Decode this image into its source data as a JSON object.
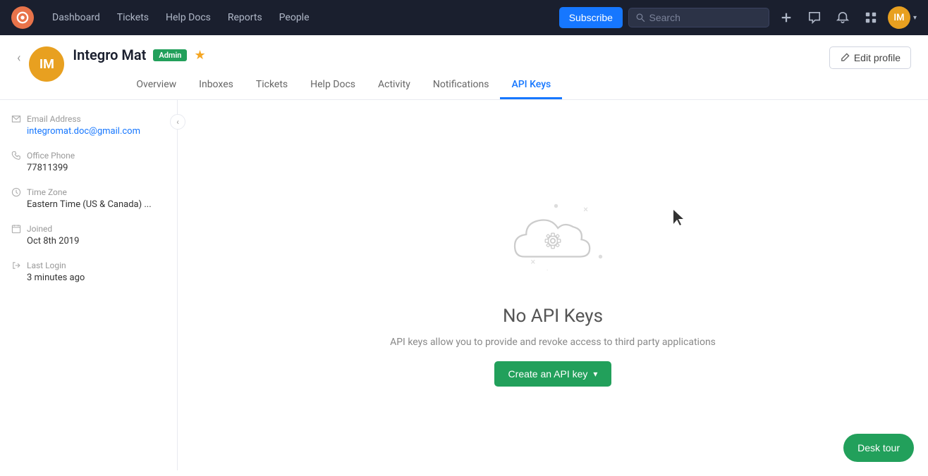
{
  "topnav": {
    "logo_letter": "○",
    "links": [
      "Dashboard",
      "Tickets",
      "Help Docs",
      "Reports",
      "People"
    ],
    "subscribe_label": "Subscribe",
    "search_placeholder": "Search",
    "add_icon": "+",
    "chat_icon": "💬",
    "bell_icon": "🔔",
    "grid_icon": "⊞",
    "avatar_initials": "IM"
  },
  "profile": {
    "avatar_initials": "IM",
    "name": "Integro Mat",
    "admin_badge": "Admin",
    "edit_profile_label": "Edit profile",
    "back_arrow": "‹",
    "star": "★"
  },
  "tabs": {
    "items": [
      {
        "label": "Overview",
        "active": false
      },
      {
        "label": "Inboxes",
        "active": false
      },
      {
        "label": "Tickets",
        "active": false
      },
      {
        "label": "Help Docs",
        "active": false
      },
      {
        "label": "Activity",
        "active": false
      },
      {
        "label": "Notifications",
        "active": false
      },
      {
        "label": "API Keys",
        "active": true
      }
    ]
  },
  "sidebar": {
    "collapse_arrow": "‹",
    "email_label": "Email Address",
    "email_value": "integromat.doc@gmail.com",
    "phone_label": "Office Phone",
    "phone_value": "77811399",
    "timezone_label": "Time Zone",
    "timezone_value": "Eastern Time (US & Canada) ...",
    "joined_label": "Joined",
    "joined_value": "Oct 8th 2019",
    "last_login_label": "Last Login",
    "last_login_value": "3 minutes ago"
  },
  "empty_state": {
    "title": "No API Keys",
    "description": "API keys allow you to provide and revoke access to third party applications",
    "create_button": "Create an API key",
    "create_button_arrow": "▾"
  },
  "desk_tour": {
    "label": "Desk tour"
  }
}
